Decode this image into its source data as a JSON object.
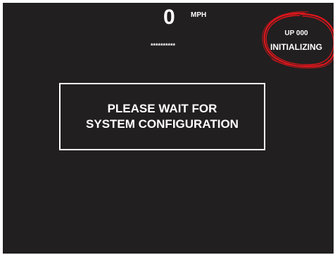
{
  "speed": {
    "value": "0",
    "unit": "MPH"
  },
  "masked_field": "**********",
  "status": {
    "code": "UP 000",
    "state": "INITIALIZING",
    "highlight_color": "#e0161b"
  },
  "message": {
    "line1": "PLEASE WAIT FOR",
    "line2": "SYSTEM CONFIGURATION"
  },
  "colors": {
    "screen_background": "#221f20",
    "text": "#ffffff"
  }
}
